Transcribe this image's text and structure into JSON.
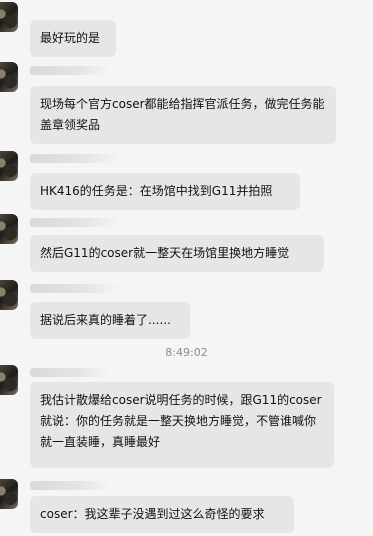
{
  "messages": [
    {
      "text": "最好玩的是"
    },
    {
      "text": "现场每个官方coser都能给指挥官派任务，做完任务能盖章领奖品"
    },
    {
      "text": "HK416的任务是：在场馆中找到G11并拍照"
    },
    {
      "text": "然后G11的coser就一整天在场馆里换地方睡觉"
    },
    {
      "text": "据说后来真的睡着了......"
    },
    {
      "text": "我估计散爆给coser说明任务的时候，跟G11的coser就说：你的任务就是一整天换地方睡觉，不管谁喊你就一直装睡，真睡最好"
    },
    {
      "text": "coser：我这辈子没遇到过这么奇怪的要求"
    }
  ],
  "timestamp": "8:49:02"
}
